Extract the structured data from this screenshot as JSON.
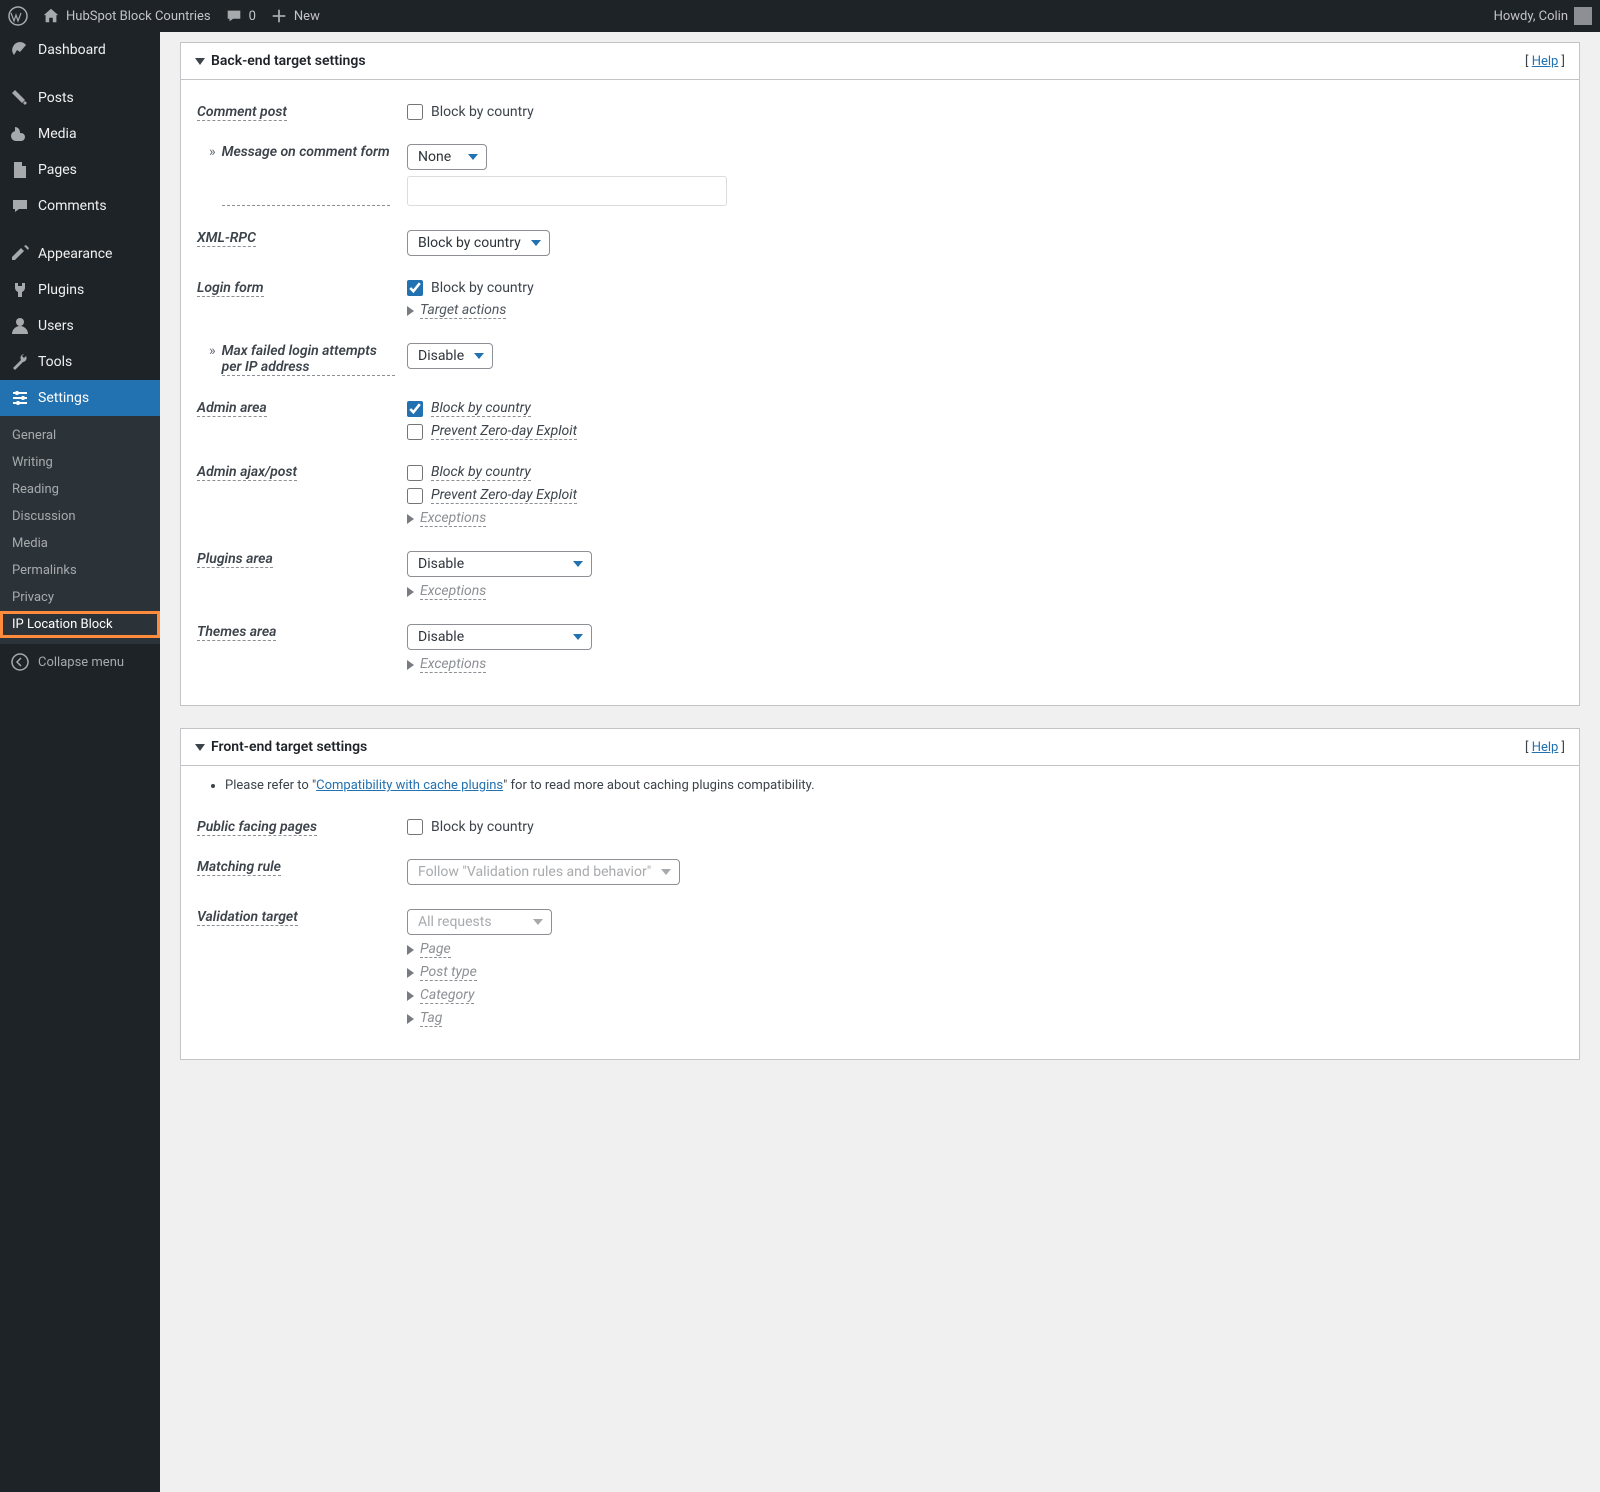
{
  "adminbar": {
    "site_name": "HubSpot Block Countries",
    "comments_count": "0",
    "new_label": "New",
    "howdy": "Howdy, Colin"
  },
  "menu": {
    "dashboard": "Dashboard",
    "posts": "Posts",
    "media": "Media",
    "pages": "Pages",
    "comments": "Comments",
    "appearance": "Appearance",
    "plugins": "Plugins",
    "users": "Users",
    "tools": "Tools",
    "settings": "Settings",
    "collapse": "Collapse menu"
  },
  "submenu": {
    "general": "General",
    "writing": "Writing",
    "reading": "Reading",
    "discussion": "Discussion",
    "media": "Media",
    "permalinks": "Permalinks",
    "privacy": "Privacy",
    "ip_location_block": "IP Location Block"
  },
  "panel1": {
    "title": "Back-end target settings",
    "help": "Help",
    "rows": {
      "comment_post": "Comment post",
      "comment_post_block": "Block by country",
      "message_comment_form": "Message on comment form",
      "message_value": "None",
      "xmlrpc": "XML-RPC",
      "xmlrpc_value": "Block by country",
      "login_form": "Login form",
      "login_form_block": "Block by country",
      "target_actions": "Target actions",
      "max_failed": "Max failed login attempts per IP address",
      "max_failed_value": "Disable",
      "admin_area": "Admin area",
      "admin_area_block": "Block by country",
      "prevent_zero_day": "Prevent Zero-day Exploit",
      "admin_ajax": "Admin ajax/post",
      "exceptions": "Exceptions",
      "plugins_area": "Plugins area",
      "plugins_value": "Disable",
      "themes_area": "Themes area",
      "themes_value": "Disable"
    }
  },
  "panel2": {
    "title": "Front-end target settings",
    "help": "Help",
    "note_pre": "Please refer to \"",
    "note_link": "Compatibility with cache plugins",
    "note_post": "\" for to read more about caching plugins compatibility.",
    "rows": {
      "public_facing": "Public facing pages",
      "public_block": "Block by country",
      "matching_rule": "Matching rule",
      "matching_value": "Follow \"Validation rules and behavior\"",
      "validation_target": "Validation target",
      "validation_value": "All requests",
      "page": "Page",
      "post_type": "Post type",
      "category": "Category",
      "tag": "Tag"
    }
  }
}
